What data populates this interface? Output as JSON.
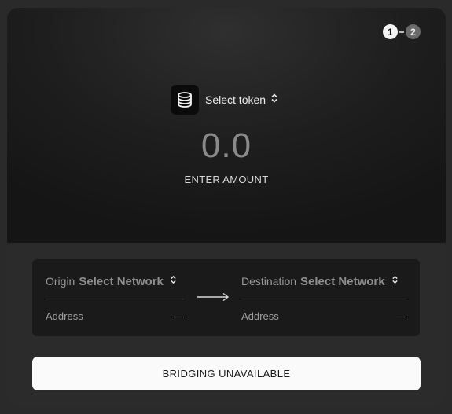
{
  "steps": [
    {
      "label": "1",
      "active": true
    },
    {
      "label": "2",
      "active": false
    }
  ],
  "token": {
    "icon": "database-stack-icon",
    "select_label": "Select token"
  },
  "amount": {
    "value": "0.0",
    "caption": "ENTER AMOUNT"
  },
  "origin": {
    "label": "Origin",
    "network": "Select Network",
    "address_label": "Address",
    "address_value": "—"
  },
  "destination": {
    "label": "Destination",
    "network": "Select Network",
    "address_label": "Address",
    "address_value": "—"
  },
  "action_button": {
    "label": "BRIDGING UNAVAILABLE"
  },
  "colors": {
    "background": "#2a2a2a",
    "panel": "#1b1b1b",
    "button": "#fafafa"
  }
}
